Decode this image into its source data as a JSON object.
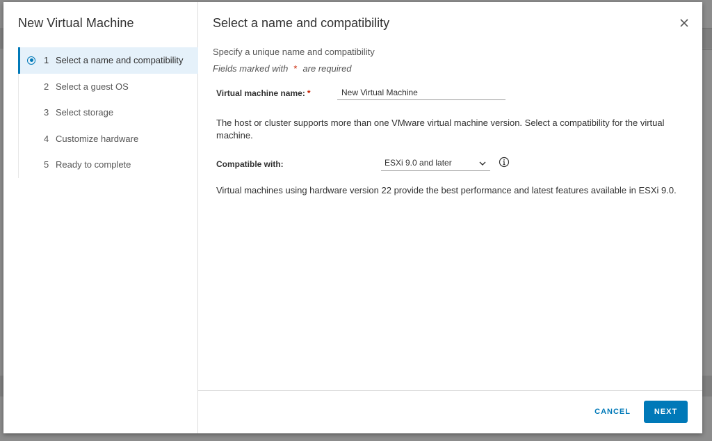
{
  "wizard": {
    "title": "New Virtual Machine",
    "steps": [
      {
        "number": "1",
        "label": "Select a name and compatibility",
        "active": true
      },
      {
        "number": "2",
        "label": "Select a guest OS",
        "active": false
      },
      {
        "number": "3",
        "label": "Select storage",
        "active": false
      },
      {
        "number": "4",
        "label": "Customize hardware",
        "active": false
      },
      {
        "number": "5",
        "label": "Ready to complete",
        "active": false
      }
    ]
  },
  "page": {
    "title": "Select a name and compatibility",
    "subtitle": "Specify a unique name and compatibility",
    "required_note_prefix": "Fields marked with",
    "required_star": "*",
    "required_note_suffix": "are required"
  },
  "form": {
    "vm_name_label": "Virtual machine name:",
    "vm_name_required": "*",
    "vm_name_value": "New Virtual Machine",
    "host_text": "The host or cluster supports more than one VMware virtual machine version. Select a compatibility for the virtual machine.",
    "compat_label": "Compatible with:",
    "compat_value": "ESXi 9.0 and later",
    "perf_text": "Virtual machines using hardware version 22 provide the best performance and latest features available in ESXi 9.0."
  },
  "footer": {
    "cancel_label": "CANCEL",
    "next_label": "NEXT"
  },
  "colors": {
    "accent": "#0079b8",
    "active_step_bg": "#e5f1fa",
    "required": "#c92100"
  },
  "icons": {
    "close": "close-icon",
    "dropdown": "chevron-down-icon",
    "info": "info-icon",
    "active_step": "radio-selected-icon"
  }
}
